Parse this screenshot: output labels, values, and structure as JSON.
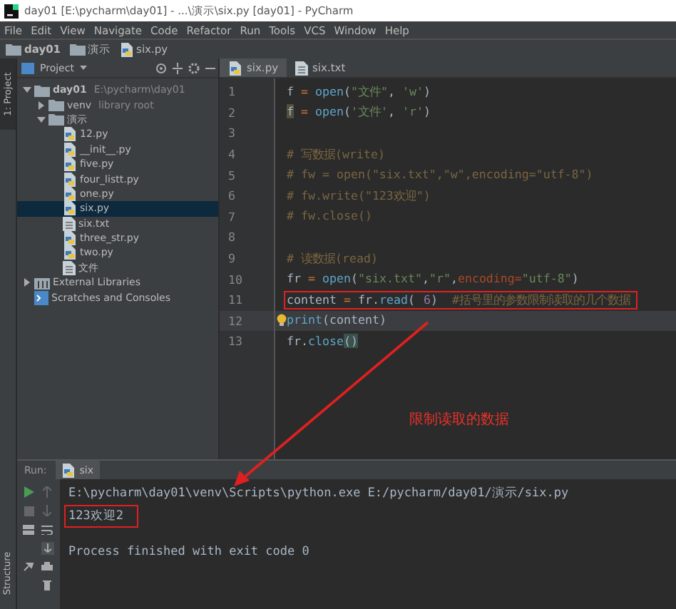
{
  "window": {
    "title": "day01 [E:\\pycharm\\day01] - ...\\演示\\six.py [day01] - PyCharm"
  },
  "menu": [
    "File",
    "Edit",
    "View",
    "Navigate",
    "Code",
    "Refactor",
    "Run",
    "Tools",
    "VCS",
    "Window",
    "Help"
  ],
  "breadcrumbs": [
    {
      "label": "day01",
      "kind": "folder"
    },
    {
      "label": "演示",
      "kind": "folder"
    },
    {
      "label": "six.py",
      "kind": "python"
    }
  ],
  "side_stripe": {
    "top": "1: Project",
    "bottom": "Structure"
  },
  "project_panel": {
    "title": "Project",
    "tree": [
      {
        "label": "day01",
        "note": "E:\\pycharm\\day01",
        "kind": "folder",
        "expanded": true,
        "selected": false,
        "children": [
          {
            "label": "venv",
            "note": "library root",
            "kind": "folder",
            "expanded": false,
            "selected": false
          },
          {
            "label": "演示",
            "kind": "folder",
            "expanded": true,
            "selected": false,
            "children": [
              {
                "label": "12.py",
                "kind": "python",
                "selected": false
              },
              {
                "label": "__init__.py",
                "kind": "python",
                "selected": false
              },
              {
                "label": "five.py",
                "kind": "python",
                "selected": false
              },
              {
                "label": "four_listt.py",
                "kind": "python",
                "selected": false
              },
              {
                "label": "one.py",
                "kind": "python",
                "selected": false
              },
              {
                "label": "six.py",
                "kind": "python",
                "selected": true
              },
              {
                "label": "six.txt",
                "kind": "text",
                "selected": false
              },
              {
                "label": "three_str.py",
                "kind": "python",
                "selected": false
              },
              {
                "label": "two.py",
                "kind": "python",
                "selected": false
              },
              {
                "label": "文件",
                "kind": "text",
                "selected": false
              }
            ]
          }
        ]
      },
      {
        "label": "External Libraries",
        "kind": "library",
        "expanded": false,
        "selected": false
      },
      {
        "label": "Scratches and Consoles",
        "kind": "scratch",
        "selected": false
      }
    ]
  },
  "editor": {
    "tabs": [
      {
        "label": "six.py",
        "kind": "python",
        "selected": true
      },
      {
        "label": "six.txt",
        "kind": "text",
        "selected": false
      }
    ],
    "lines": [
      {
        "number": "1",
        "current": false,
        "annotated": false,
        "segments": [
          {
            "text": "f",
            "kind": "name"
          },
          {
            "text": " = ",
            "kind": "op"
          },
          {
            "text": "open",
            "kind": "func"
          },
          {
            "text": "(",
            "kind": "name"
          },
          {
            "text": "\"文件\"",
            "kind": "str"
          },
          {
            "text": ", ",
            "kind": "name"
          },
          {
            "text": "'w'",
            "kind": "str"
          },
          {
            "text": ")",
            "kind": "name"
          }
        ]
      },
      {
        "number": "2",
        "current": false,
        "annotated": false,
        "segments": [
          {
            "text": "f",
            "kind": "mark"
          },
          {
            "text": " = ",
            "kind": "op"
          },
          {
            "text": "open",
            "kind": "func"
          },
          {
            "text": "(",
            "kind": "name"
          },
          {
            "text": "'文件'",
            "kind": "str"
          },
          {
            "text": ", ",
            "kind": "name"
          },
          {
            "text": "'r'",
            "kind": "str"
          },
          {
            "text": ")",
            "kind": "name"
          }
        ]
      },
      {
        "number": "3",
        "current": false,
        "annotated": false
      },
      {
        "number": "4",
        "current": false,
        "annotated": false,
        "segments": [
          {
            "text": "# 写数据(write)",
            "kind": "comment"
          }
        ]
      },
      {
        "number": "5",
        "current": false,
        "annotated": false,
        "segments": [
          {
            "text": "# fw = open(\"six.txt\",\"w\",encoding=\"utf-8\")",
            "kind": "comment"
          }
        ]
      },
      {
        "number": "6",
        "current": false,
        "annotated": false,
        "segments": [
          {
            "text": "# fw.write(\"123欢迎\")",
            "kind": "comment"
          }
        ]
      },
      {
        "number": "7",
        "current": false,
        "annotated": false,
        "segments": [
          {
            "text": "# fw.close()",
            "kind": "comment"
          }
        ]
      },
      {
        "number": "8",
        "current": false,
        "annotated": false
      },
      {
        "number": "9",
        "current": false,
        "annotated": false,
        "segments": [
          {
            "text": "# 读数据(read)",
            "kind": "comment"
          }
        ]
      },
      {
        "number": "10",
        "current": false,
        "annotated": false,
        "segments": [
          {
            "text": "fr",
            "kind": "name"
          },
          {
            "text": " = ",
            "kind": "op"
          },
          {
            "text": "open",
            "kind": "func"
          },
          {
            "text": "(",
            "kind": "name"
          },
          {
            "text": "\"six.txt\"",
            "kind": "str"
          },
          {
            "text": ",",
            "kind": "name"
          },
          {
            "text": "\"r\"",
            "kind": "str"
          },
          {
            "text": ",",
            "kind": "name"
          },
          {
            "text": "encoding=",
            "kind": "param"
          },
          {
            "text": "\"utf-8\"",
            "kind": "str"
          },
          {
            "text": ")",
            "kind": "name"
          }
        ]
      },
      {
        "number": "11",
        "current": false,
        "annotated": true,
        "segments": [
          {
            "text": "content",
            "kind": "name"
          },
          {
            "text": " = ",
            "kind": "op"
          },
          {
            "text": "fr.",
            "kind": "name"
          },
          {
            "text": "read",
            "kind": "func"
          },
          {
            "text": "(",
            "kind": "name"
          },
          {
            "text": "6",
            "kind": "num"
          },
          {
            "text": ")  ",
            "kind": "name"
          },
          {
            "text": "#括号里的参数限制读取的几个数据",
            "kind": "comment"
          }
        ]
      },
      {
        "number": "12",
        "current": true,
        "annotated": false,
        "segments": [
          {
            "text": "print",
            "kind": "func"
          },
          {
            "text": "(content)",
            "kind": "name"
          }
        ]
      },
      {
        "number": "13",
        "current": false,
        "annotated": false,
        "segments": [
          {
            "text": "fr.",
            "kind": "name"
          },
          {
            "text": "close",
            "kind": "func"
          },
          {
            "text": "()",
            "kind": "brace"
          }
        ]
      }
    ],
    "annotation": {
      "text": "限制读取的数据"
    }
  },
  "run_panel": {
    "label": "Run:",
    "tabs": [
      {
        "label": "six",
        "selected": true
      }
    ],
    "console": [
      {
        "text": "E:\\pycharm\\day01\\venv\\Scripts\\python.exe E:/pycharm/day01/演示/six.py",
        "annotated": false
      },
      {
        "text": "123欢迎2",
        "annotated": true
      },
      {
        "text": "Process finished with exit code 0",
        "annotated": false
      }
    ]
  }
}
